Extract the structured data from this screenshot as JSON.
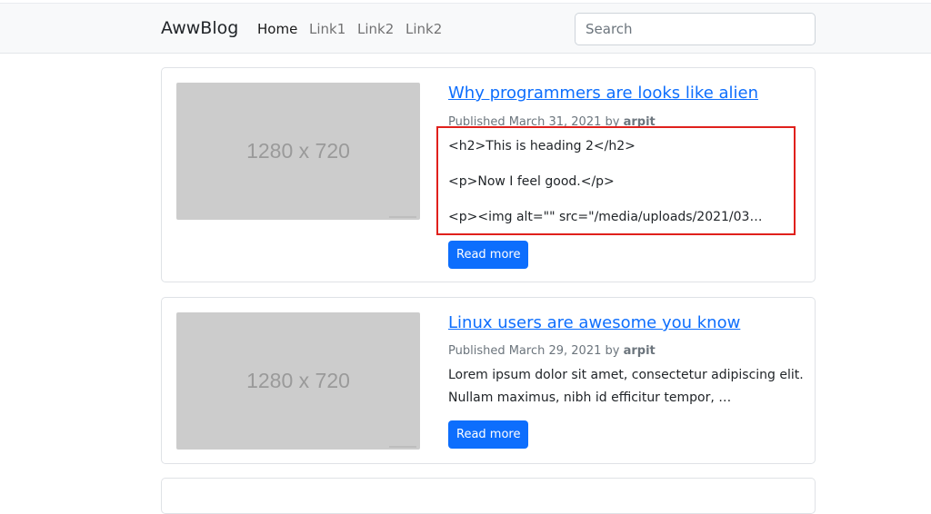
{
  "navbar": {
    "brand": "AwwBlog",
    "links": [
      {
        "label": "Home",
        "active": true
      },
      {
        "label": "Link1",
        "active": false
      },
      {
        "label": "Link2",
        "active": false
      },
      {
        "label": "Link2",
        "active": false
      }
    ],
    "search": {
      "placeholder": "Search",
      "value": ""
    }
  },
  "posts": [
    {
      "thumbnail_label": "1280 x 720",
      "title": "Why programmers are looks like alien",
      "meta_prefix": "Published March 31, 2021 by",
      "author": "arpit",
      "excerpt_lines": [
        "<h2>This is heading 2</h2>",
        "<p>Now I feel good.</p>",
        "<p><img alt=\"\" src=\"/media/uploads/2021/03…"
      ],
      "button_label": "Read more"
    },
    {
      "thumbnail_label": "1280 x 720",
      "title": "Linux users are awesome you know",
      "meta_prefix": "Published March 29, 2021 by",
      "author": "arpit",
      "excerpt_lines": [
        "Lorem ipsum dolor sit amet, consectetur adipiscing elit.",
        "Nullam maximus, nibh id efficitur tempor, …"
      ],
      "button_label": "Read more"
    }
  ],
  "colors": {
    "accent": "#0d6efd",
    "highlight_box": "#e0201c",
    "placeholder_bg": "#cccccc"
  }
}
